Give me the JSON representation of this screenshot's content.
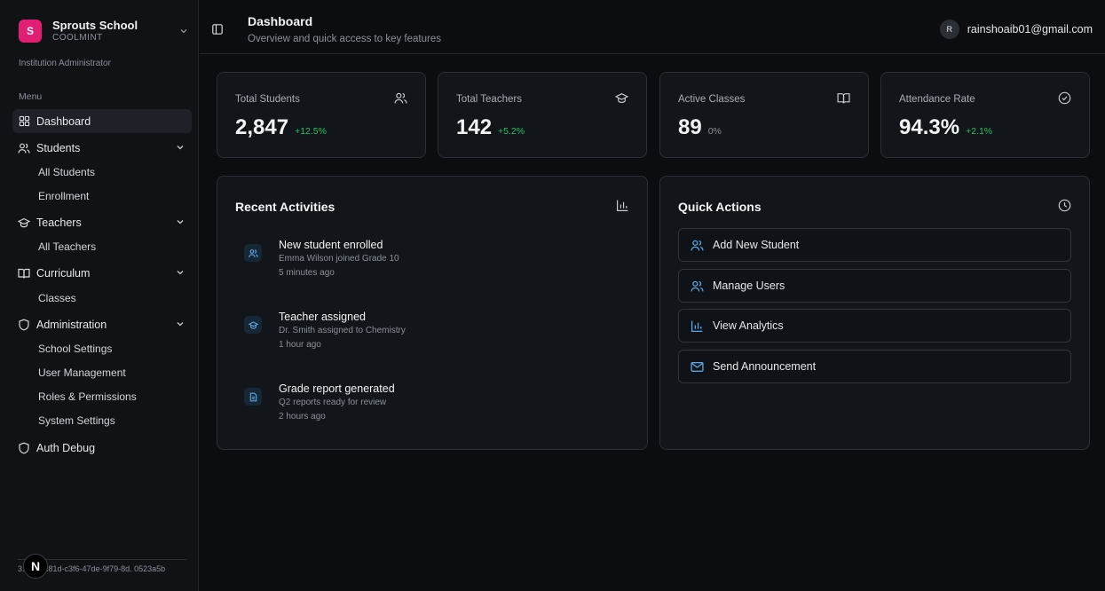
{
  "sidebar": {
    "org_name": "Sprouts School",
    "org_code": "COOLMINT",
    "org_logo": "S",
    "role": "Institution Administrator",
    "menu_label": "Menu",
    "items": {
      "dashboard": "Dashboard",
      "students": "Students",
      "all_students": "All Students",
      "enrollment": "Enrollment",
      "teachers": "Teachers",
      "all_teachers": "All Teachers",
      "curriculum": "Curriculum",
      "classes": "Classes",
      "administration": "Administration",
      "school_settings": "School Settings",
      "user_management": "User Management",
      "roles_permissions": "Roles & Permissions",
      "system_settings": "System Settings",
      "auth_debug": "Auth Debug"
    },
    "footer_id": "3. 9816c81d-c3f6-47de-9f79-8d. 0523a5b",
    "next_badge": "N"
  },
  "header": {
    "title": "Dashboard",
    "subtitle": "Overview and quick access to key features",
    "user_initial": "R",
    "user_email": "rainshoaib01@gmail.com"
  },
  "stats": [
    {
      "label": "Total Students",
      "value": "2,847",
      "delta": "+12.5%",
      "icon": "users-icon"
    },
    {
      "label": "Total Teachers",
      "value": "142",
      "delta": "+5.2%",
      "icon": "graduation-cap-icon"
    },
    {
      "label": "Active Classes",
      "value": "89",
      "delta": "0%",
      "icon": "book-open-icon"
    },
    {
      "label": "Attendance Rate",
      "value": "94.3%",
      "delta": "+2.1%",
      "icon": "check-circle-icon"
    }
  ],
  "recent": {
    "title": "Recent Activities",
    "items": [
      {
        "title": "New student enrolled",
        "desc": "Emma Wilson joined Grade 10",
        "time": "5 minutes ago"
      },
      {
        "title": "Teacher assigned",
        "desc": "Dr. Smith assigned to Chemistry",
        "time": "1 hour ago"
      },
      {
        "title": "Grade report generated",
        "desc": "Q2 reports ready for review",
        "time": "2 hours ago"
      }
    ]
  },
  "quick": {
    "title": "Quick Actions",
    "actions": [
      "Add New Student",
      "Manage Users",
      "View Analytics",
      "Send Announcement"
    ]
  },
  "colors": {
    "accent": "#5ba8e6",
    "positive": "#22c55e",
    "logo": "#e11d74"
  }
}
